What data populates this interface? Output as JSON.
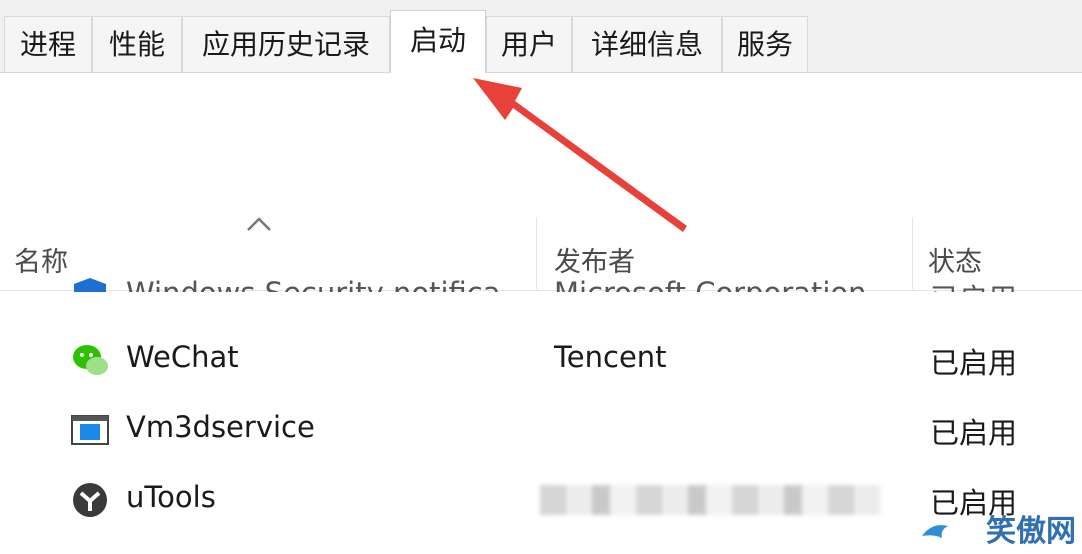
{
  "tabs": [
    {
      "label": "进程"
    },
    {
      "label": "性能"
    },
    {
      "label": "应用历史记录"
    },
    {
      "label": "启动",
      "active": true
    },
    {
      "label": "用户"
    },
    {
      "label": "详细信息"
    },
    {
      "label": "服务"
    }
  ],
  "columns": {
    "name": "名称",
    "publisher": "发布者",
    "status": "状态"
  },
  "rows": [
    {
      "name": "Windows Security notifica...",
      "publisher": "Microsoft Corporation",
      "status": "已启用",
      "icon": "windows-security-shield-icon"
    },
    {
      "name": "WeChat",
      "publisher": "Tencent",
      "status": "已启用",
      "icon": "wechat-icon"
    },
    {
      "name": "Vm3dservice",
      "publisher": "",
      "status": "已启用",
      "icon": "vm3dservice-window-icon"
    },
    {
      "name": "uTools",
      "publisher": "",
      "status": "已启用",
      "icon": "utools-icon"
    }
  ],
  "watermark": {
    "text": "笑傲网"
  },
  "colors": {
    "annotation_arrow": "#e8413a",
    "tab_bar": "#f0f0f0",
    "watermark": "#2f6fb2"
  }
}
